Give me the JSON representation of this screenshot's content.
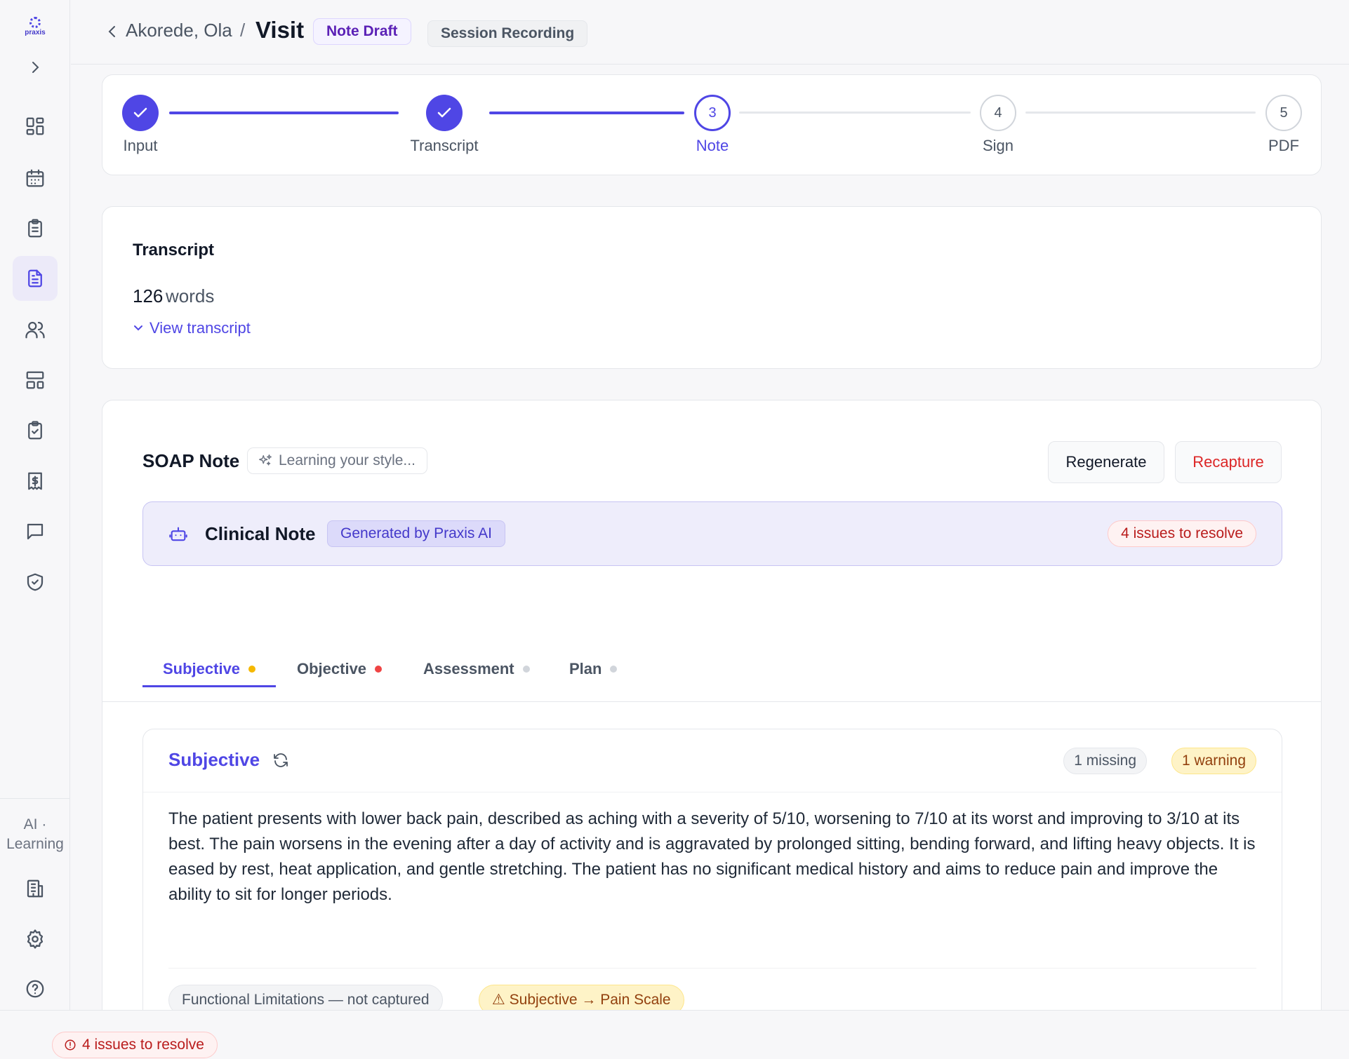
{
  "app": {
    "logo_text": "praxis"
  },
  "sidebar": {
    "items": [
      {
        "name": "dashboard",
        "icon": "grid-icon",
        "active": false
      },
      {
        "name": "calendar",
        "icon": "calendar-icon",
        "active": false
      },
      {
        "name": "tasks",
        "icon": "clipboard-list-icon",
        "active": false
      },
      {
        "name": "notes",
        "icon": "document-icon",
        "active": true
      },
      {
        "name": "patients",
        "icon": "users-icon",
        "active": false
      },
      {
        "name": "templates",
        "icon": "layout-icon",
        "active": false
      },
      {
        "name": "checklist",
        "icon": "clipboard-check-icon",
        "active": false
      },
      {
        "name": "billing",
        "icon": "dollar-receipt-icon",
        "active": false
      },
      {
        "name": "messages",
        "icon": "chat-icon",
        "active": false
      },
      {
        "name": "compliance",
        "icon": "shield-check-icon",
        "active": false
      }
    ],
    "ai_learning_line1": "AI ·",
    "ai_learning_line2": "Learning",
    "bottom_items": [
      {
        "name": "organization",
        "icon": "building-icon"
      },
      {
        "name": "settings",
        "icon": "gear-icon"
      },
      {
        "name": "help",
        "icon": "help-circle-icon"
      }
    ]
  },
  "header": {
    "patient": "Akorede, Ola",
    "separator": "/",
    "page": "Visit",
    "status_badge": "Note Draft",
    "recording_badge": "Session Recording"
  },
  "stepper": {
    "steps": [
      {
        "number": "1",
        "label": "Input",
        "state": "done"
      },
      {
        "number": "2",
        "label": "Transcript",
        "state": "done"
      },
      {
        "number": "3",
        "label": "Note",
        "state": "current"
      },
      {
        "number": "4",
        "label": "Sign",
        "state": "upcoming"
      },
      {
        "number": "5",
        "label": "PDF",
        "state": "upcoming"
      }
    ]
  },
  "transcript": {
    "title": "Transcript",
    "word_count": "126",
    "word_unit": "words",
    "view_link": "View transcript"
  },
  "soap": {
    "title": "SOAP Note",
    "learning_chip": "Learning your style...",
    "regenerate_label": "Regenerate",
    "recapture_label": "Recapture",
    "banner": {
      "title": "Clinical Note",
      "generated_badge": "Generated by Praxis AI",
      "issues_badge": "4 issues to resolve"
    },
    "tabs": [
      {
        "label": "Subjective",
        "dot_color": "#f5b800",
        "active": true
      },
      {
        "label": "Objective",
        "dot_color": "#ef4444",
        "active": false
      },
      {
        "label": "Assessment",
        "dot_color": "#d1d5db",
        "active": false
      },
      {
        "label": "Plan",
        "dot_color": "#d1d5db",
        "active": false
      }
    ],
    "section": {
      "title": "Subjective",
      "missing_pill": "1 missing",
      "warning_pill": "1 warning",
      "body": "The patient presents with lower back pain, described as aching with a severity of 5/10, worsening to 7/10 at its worst and improving to 3/10 at its best. The pain worsens in the evening after a day of activity and is aggravated by prolonged sitting, bending forward, and lifting heavy objects. It is eased by rest, heat application, and gentle stretching. The patient has no significant medical history and aims to reduce pain and improve the ability to sit for longer periods.",
      "missing_tag": "Functional Limitations — not captured",
      "warning_tag": "⚠ Subjective → Pain Scale"
    }
  },
  "footer": {
    "issues_label": "4 issues to resolve"
  },
  "colors": {
    "accent": "#4f46e5",
    "danger": "#dc2626",
    "warning": "#f5b800",
    "neutral_dot": "#d1d5db"
  }
}
